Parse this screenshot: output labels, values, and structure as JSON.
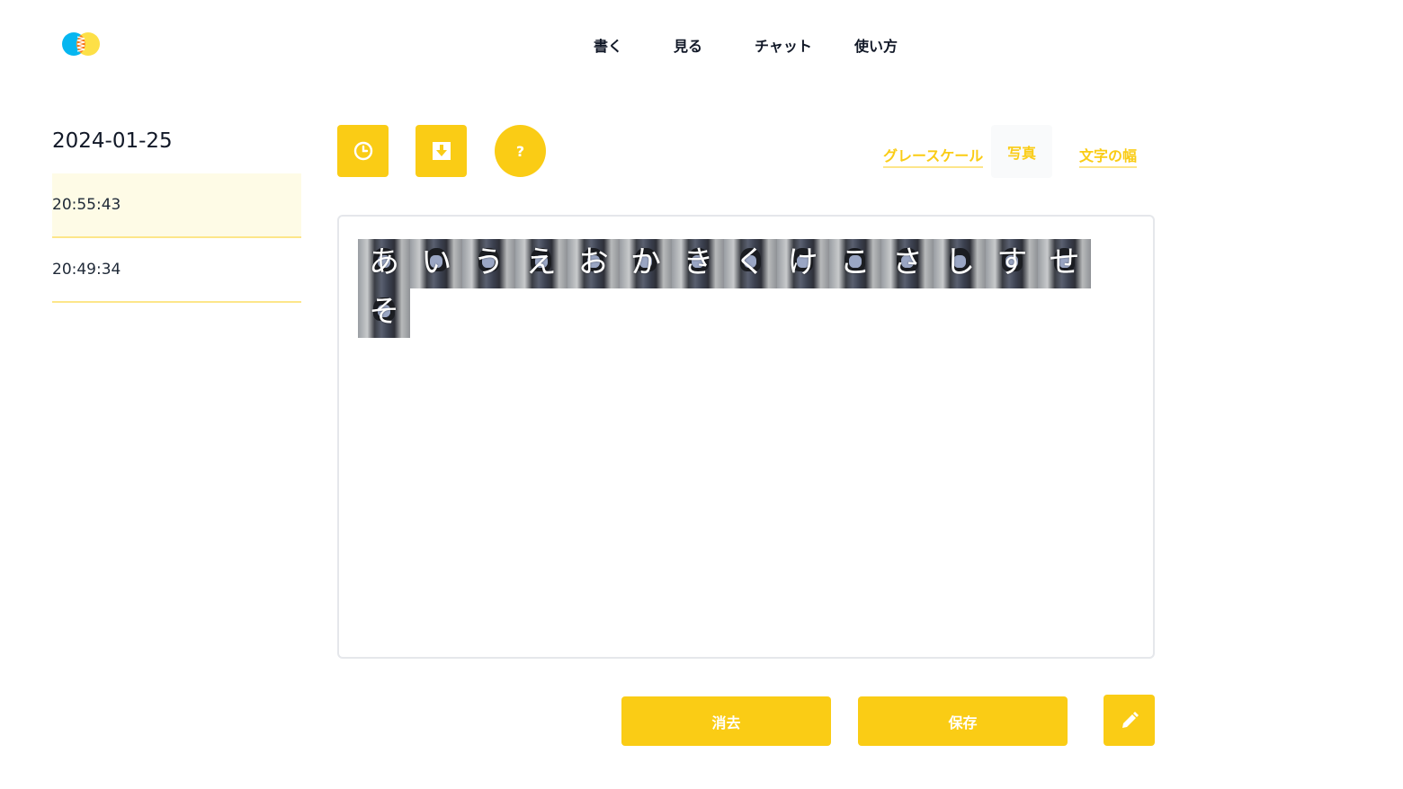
{
  "header": {
    "logo_icon": "brand-logo-icon",
    "nav": [
      {
        "label": "書く"
      },
      {
        "label": "見る"
      },
      {
        "label": "チャット"
      },
      {
        "label": "使い方"
      }
    ]
  },
  "sidebar": {
    "date": "2024-01-25",
    "items": [
      {
        "label": "20:55:43",
        "active": true
      },
      {
        "label": "20:49:34",
        "active": false
      }
    ]
  },
  "toolbar": {
    "buttons": [
      {
        "icon": "clock-icon"
      },
      {
        "icon": "download-icon"
      },
      {
        "icon": "help-icon",
        "label": "?"
      }
    ],
    "view_options": [
      {
        "label": "グレースケール"
      },
      {
        "label": "写真",
        "selected": true
      },
      {
        "label": "文字の幅"
      }
    ]
  },
  "canvas": {
    "characters": [
      "あ",
      "い",
      "う",
      "え",
      "お",
      "か",
      "き",
      "く",
      "け",
      "こ",
      "さ",
      "し",
      "す",
      "せ",
      "そ"
    ]
  },
  "actions": {
    "clear_label": "消去",
    "save_label": "保存",
    "edit_icon": "pencil-icon"
  },
  "colors": {
    "accent": "#facc15",
    "accent_light": "#fde68a",
    "active_row": "#fefbe6"
  }
}
